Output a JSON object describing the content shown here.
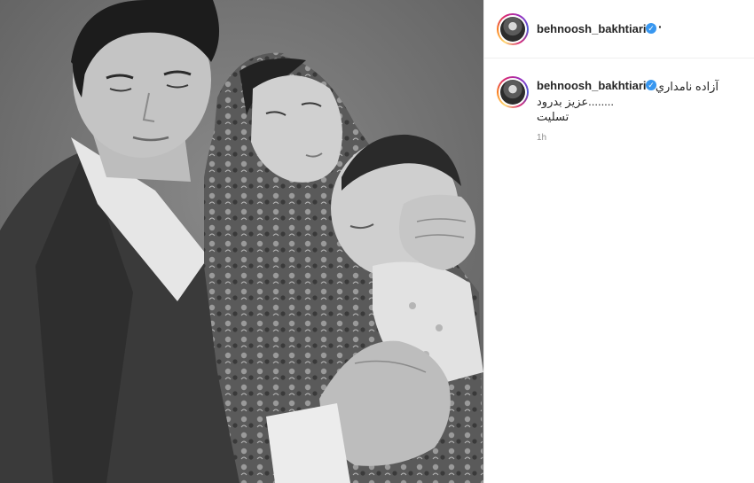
{
  "post": {
    "header": {
      "username": "behnoosh_bakhtiari",
      "verified_glyph": "✓",
      "separator": "·"
    },
    "caption": {
      "username": "behnoosh_bakhtiari",
      "verified_glyph": "✓",
      "line_1": "آزاده نامداري",
      "line_2": "........عزيز بدرود",
      "line_3": "تسليت"
    },
    "timestamp": "1h",
    "photo": {
      "icon": "photo-image",
      "description_colors": {
        "background": "#777777",
        "suit": "#3a3a3a",
        "shirt": "#e8e8e8",
        "skin": "#c9c9c9",
        "hair": "#1c1c1c",
        "scarf": "#5e5e5e"
      }
    }
  },
  "colors": {
    "verified": "#3897f0",
    "text_primary": "#262626",
    "text_secondary": "#8e8e8e",
    "divider": "#efefef"
  }
}
